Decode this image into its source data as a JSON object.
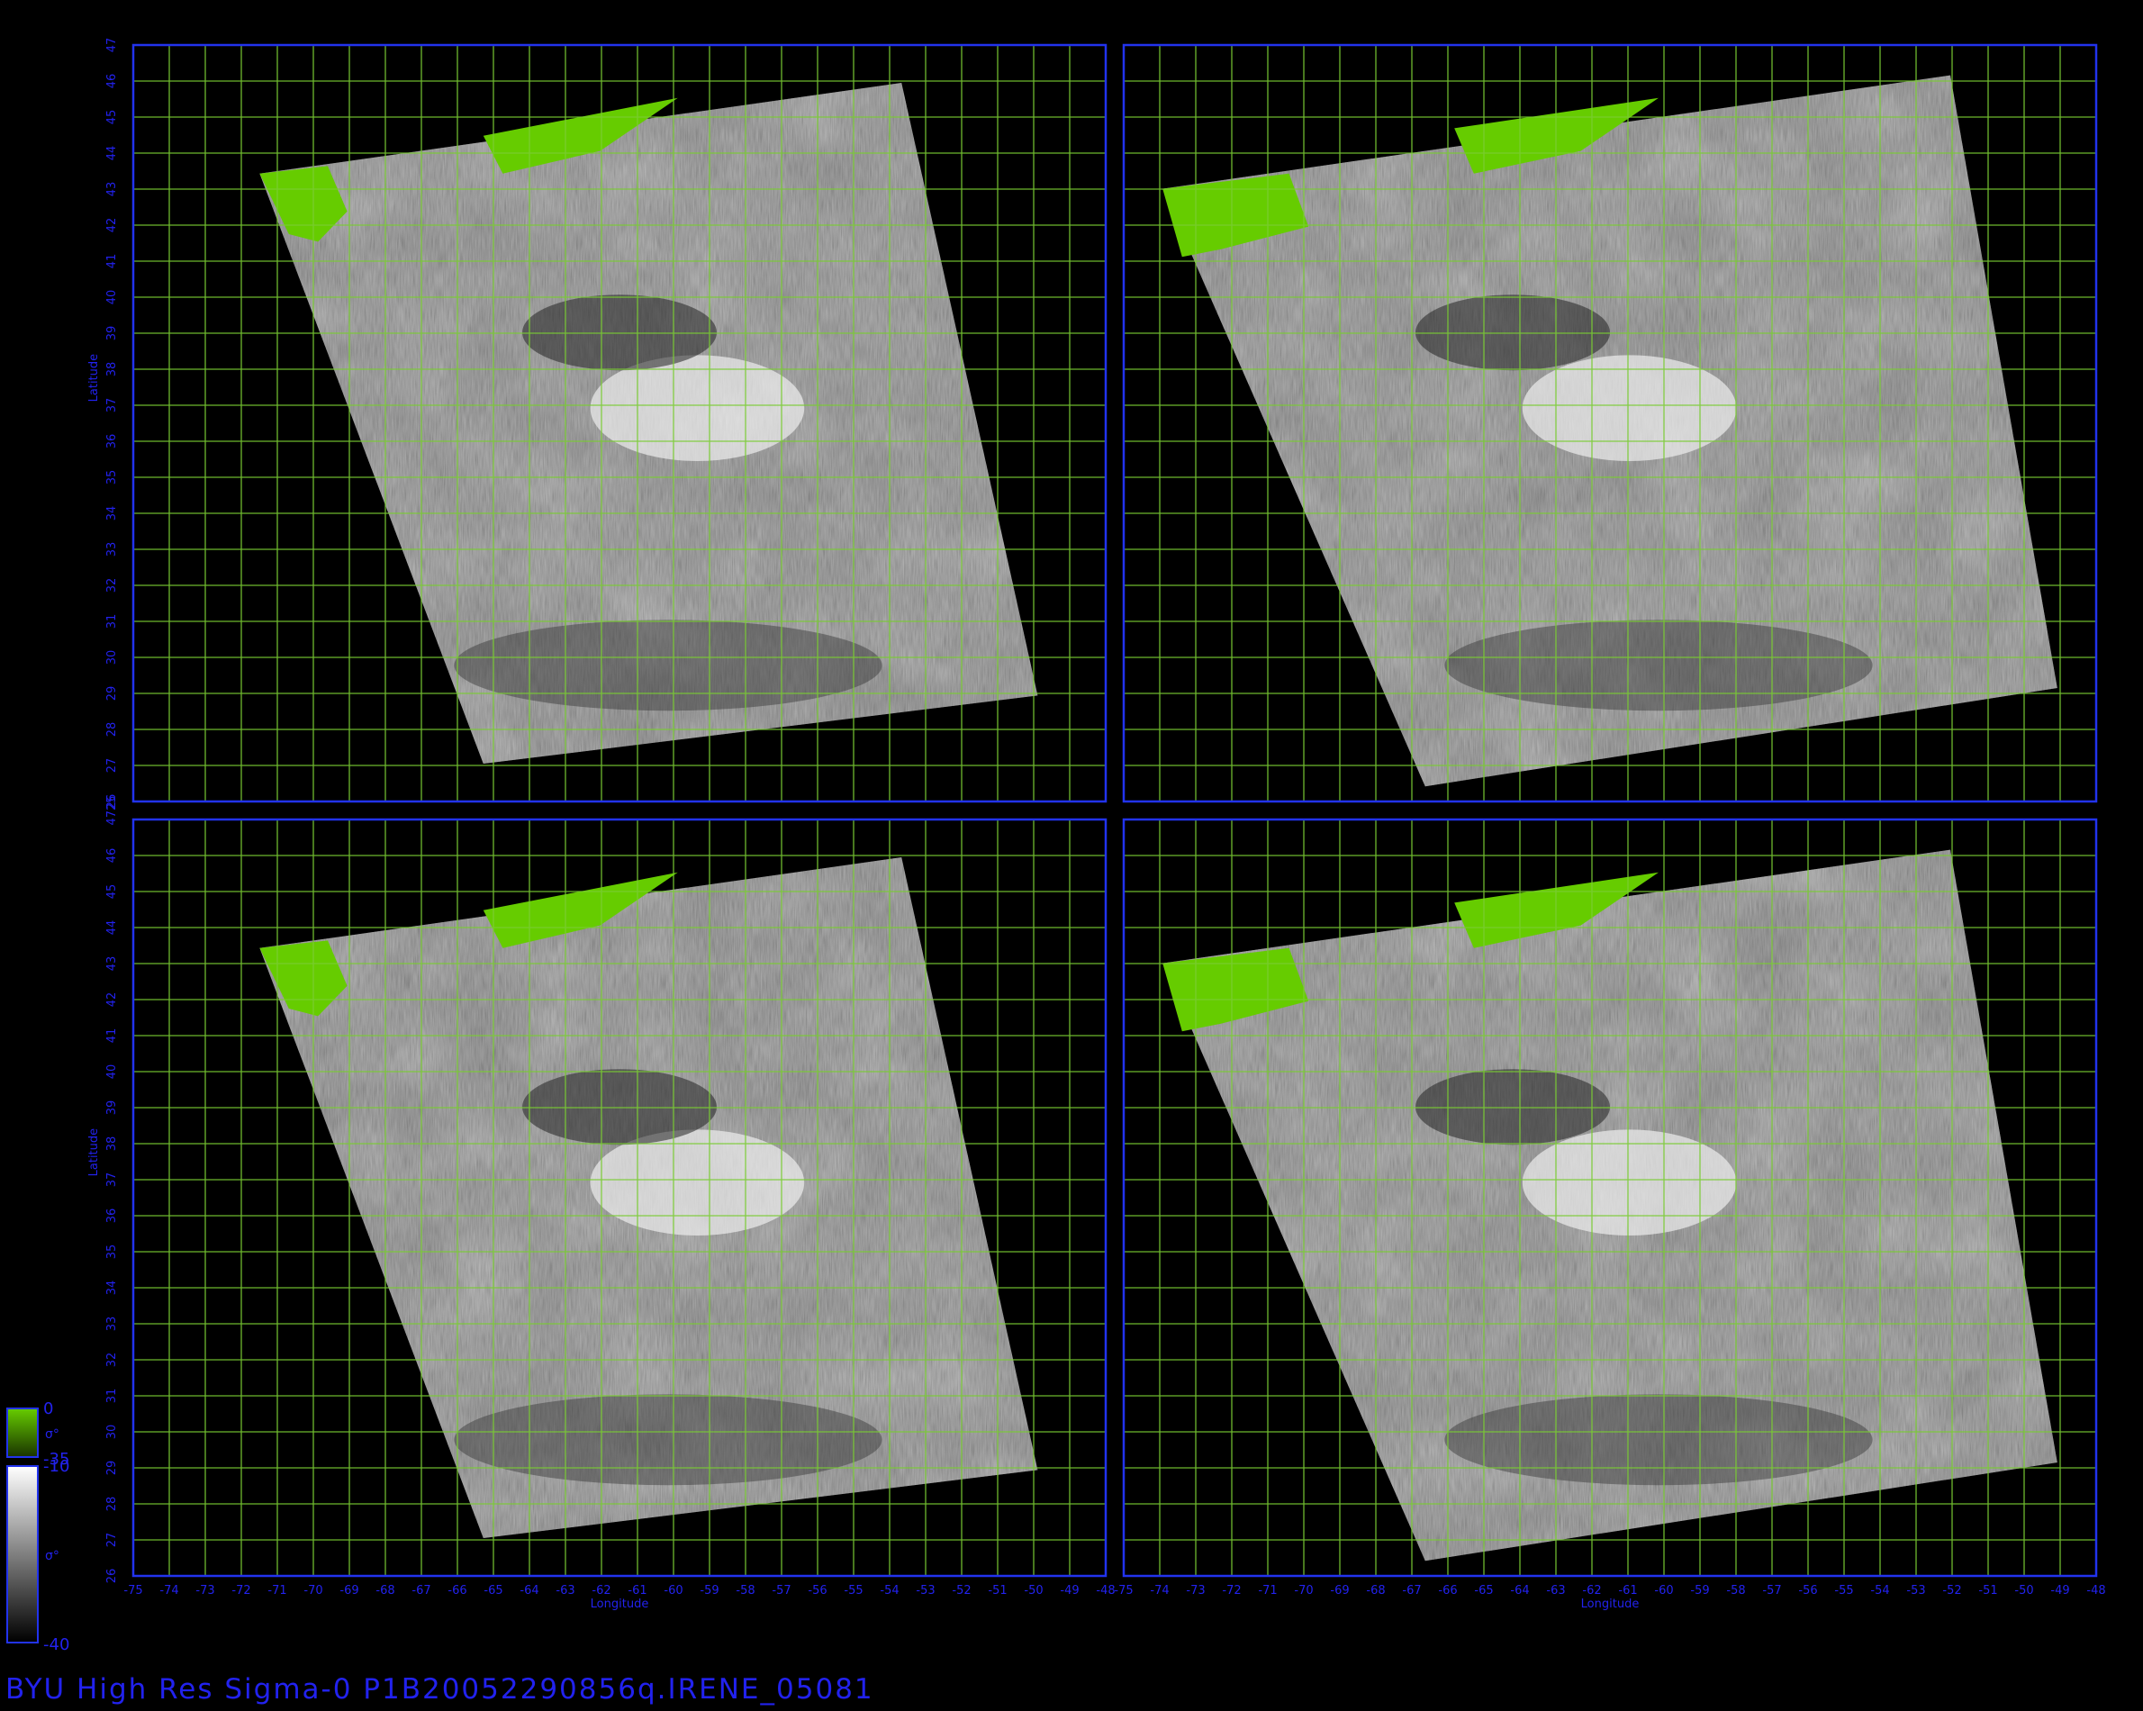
{
  "title": "BYU High Res Sigma-0 P1B20052290856q.IRENE_05081",
  "axes": {
    "xlabel": "Longitude",
    "ylabel": "Latitude",
    "top_lat_label": "47",
    "corner_label": "4725",
    "panels": [
      {
        "lon_ticks": [
          "-75",
          "-74",
          "-73",
          "-72",
          "-71",
          "-70",
          "-69",
          "-68",
          "-67",
          "-66",
          "-65",
          "-64",
          "-63",
          "-62",
          "-61",
          "-60",
          "-59",
          "-58",
          "-57",
          "-56",
          "-55",
          "-54",
          "-53",
          "-52",
          "-51",
          "-50",
          "-49",
          "-48"
        ],
        "lat_ticks": [
          "26",
          "27",
          "28",
          "29",
          "30",
          "31",
          "32",
          "33",
          "34",
          "35",
          "36",
          "37",
          "38",
          "39",
          "40",
          "41",
          "42",
          "43",
          "44",
          "45",
          "46"
        ]
      },
      {
        "lon_ticks": [
          "-75",
          "-74",
          "-73",
          "-72",
          "-71",
          "-70",
          "-69",
          "-68",
          "-67",
          "-66",
          "-65",
          "-64",
          "-63",
          "-62",
          "-61",
          "-60",
          "-59",
          "-58",
          "-57",
          "-56",
          "-55",
          "-54",
          "-53",
          "-52",
          "-51",
          "-50",
          "-49",
          "-48"
        ],
        "lat_ticks": [
          "26",
          "27",
          "28",
          "29",
          "30",
          "31",
          "32",
          "33",
          "34",
          "35",
          "36",
          "37",
          "38",
          "39",
          "40",
          "41",
          "42",
          "43",
          "44",
          "45",
          "46"
        ]
      }
    ],
    "lon_range": [
      -75,
      -48
    ],
    "lat_range": [
      26,
      47
    ]
  },
  "colorbars": [
    {
      "label": "σ°",
      "min": "-35",
      "max": "0",
      "colors": [
        "#1a3300",
        "#66cc00"
      ]
    },
    {
      "label": "σ°",
      "min": "-40",
      "max": "-10",
      "colors": [
        "#000000",
        "#ffffff"
      ]
    }
  ],
  "colors": {
    "frame": "#2233ee",
    "grid": "#7acc33",
    "land": "#66cc00",
    "labels": "#2222ee"
  }
}
